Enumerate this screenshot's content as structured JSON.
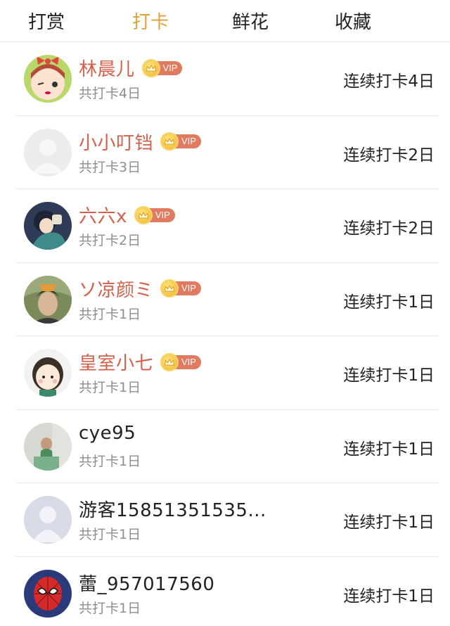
{
  "tabs": [
    {
      "label": "打赏",
      "active": false
    },
    {
      "label": "打卡",
      "active": true
    },
    {
      "label": "鲜花",
      "active": false
    },
    {
      "label": "收藏",
      "active": false
    }
  ],
  "vip_badge_label": "VIP",
  "colors": {
    "active_tab": "#e0a23c",
    "vip_name": "#d4604a",
    "vip_badge": "#e07a60",
    "secondary_text": "#8e8e8e"
  },
  "users": [
    {
      "name": "林晨儿",
      "vip": true,
      "total": "共打卡4日",
      "streak": "连续打卡4日",
      "avatar": "cartoon-girl-bow"
    },
    {
      "name": "小小叮铛",
      "vip": true,
      "total": "共打卡3日",
      "streak": "连续打卡2日",
      "avatar": "default-blank"
    },
    {
      "name": "六六x",
      "vip": true,
      "total": "共打卡2日",
      "streak": "连续打卡2日",
      "avatar": "illustration-girl"
    },
    {
      "name": "ソ凉颜ミ",
      "vip": true,
      "total": "共打卡1日",
      "streak": "连续打卡1日",
      "avatar": "photo-boy"
    },
    {
      "name": "皇室小七",
      "vip": true,
      "total": "共打卡1日",
      "streak": "连续打卡1日",
      "avatar": "cartoon-girl"
    },
    {
      "name": "cye95",
      "vip": false,
      "total": "共打卡1日",
      "streak": "连续打卡1日",
      "avatar": "photo-child"
    },
    {
      "name": "游客15851351535...",
      "vip": false,
      "total": "共打卡1日",
      "streak": "连续打卡1日",
      "avatar": "default-silhouette"
    },
    {
      "name": "蕾_957017560",
      "vip": false,
      "total": "共打卡1日",
      "streak": "连续打卡1日",
      "avatar": "spiderman"
    }
  ]
}
